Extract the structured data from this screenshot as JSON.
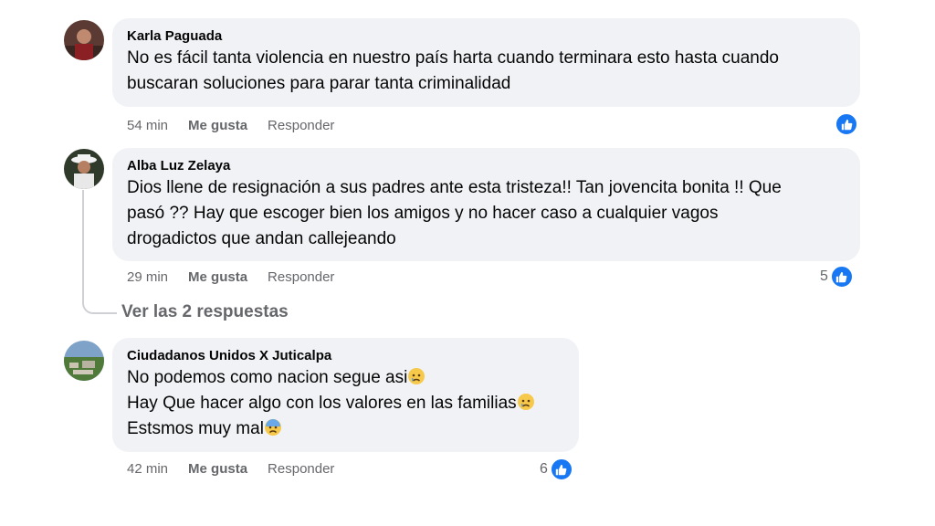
{
  "comments": [
    {
      "author": "Karla Paguada",
      "lines": [
        "No es fácil tanta violencia en nuestro país harta cuando terminara esto hasta cuando",
        "buscaran soluciones para parar tanta criminalidad"
      ],
      "time": "54 min",
      "like_label": "Me gusta",
      "reply_label": "Responder",
      "reaction_count": ""
    },
    {
      "author": "Alba Luz Zelaya",
      "lines": [
        "Dios llene de resignación a sus padres ante esta tristeza!! Tan jovencita bonita !! Que",
        "pasó ?? Hay que escoger bien los amigos y no hacer caso a cualquier vagos",
        "drogadictos que andan callejeando"
      ],
      "time": "29 min",
      "like_label": "Me gusta",
      "reply_label": "Responder",
      "reaction_count": "5",
      "view_replies": "Ver las 2 respuestas"
    },
    {
      "author": "Ciudadanos Unidos X Juticalpa",
      "lines": [
        "No podemos como nacion segue asi",
        "Hay Que hacer algo con los valores en las familias",
        "Estsmos muy mal"
      ],
      "time": "42 min",
      "like_label": "Me gusta",
      "reply_label": "Responder",
      "reaction_count": "6"
    }
  ],
  "colors": {
    "bubble": "#f0f2f5",
    "like_blue": "#1877f2",
    "meta_gray": "#65676b"
  },
  "icons": [
    "like-icon",
    "sad-face-emoji",
    "anxious-face-emoji"
  ]
}
